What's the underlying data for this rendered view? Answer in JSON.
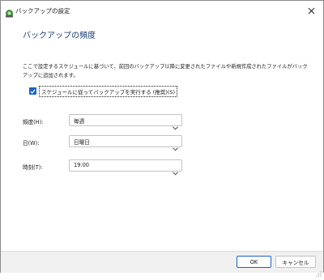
{
  "window": {
    "title": "バックアップの設定",
    "close_glyph": "✕"
  },
  "main": {
    "heading": "バックアップの頻度",
    "description": "ここで設定するスケジュールに基づいて、前回のバックアップ以降に変更されたファイルや新規作成されたファイルがバックアップに追加されます。",
    "schedule_checkbox": {
      "label": "スケジュールに従ってバックアップを実行する (推奨)(S)",
      "checked": true
    },
    "fields": {
      "frequency": {
        "label": "頻度(H):",
        "value": "毎週"
      },
      "day": {
        "label": "日(W):",
        "value": "日曜日"
      },
      "time": {
        "label": "時刻(T):",
        "value": "19:00"
      }
    }
  },
  "footer": {
    "ok_label": "OK",
    "cancel_label": "キャンセル"
  },
  "colors": {
    "accent": "#1b62c9",
    "heading": "#1c3e7a",
    "footer_bg": "#f0f0f0"
  }
}
